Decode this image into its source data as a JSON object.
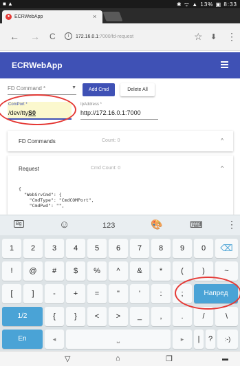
{
  "status": {
    "left_icons": "■ ▲",
    "right_text": "✱ ᯤ ▲ 13% ▣ 8:33"
  },
  "browser": {
    "tab_title": "ECRWebApp",
    "tab_close": "×",
    "back": "←",
    "forward": "→",
    "reload": "C",
    "url_host": "172.16.0.1",
    "url_path": ":7000/fd-request",
    "star": "☆",
    "download": "⬇",
    "more": "⋮"
  },
  "app": {
    "title": "ECRWebApp",
    "fd_command_placeholder": "FD Command *",
    "add_cmd_label": "Add Cmd",
    "delete_all_label": "Delete All",
    "comport_label": "ComPort *",
    "comport_value_prefix": "/dev/tty",
    "comport_value_highlight": "S0",
    "ip_label": "IpAddress *",
    "ip_value": "http://172.16.0.1:7000",
    "fd_commands_title": "FD Commands",
    "fd_commands_count": "Count: 0",
    "request_title": "Request",
    "request_count": "Cmd Count: 0",
    "request_code": "{\n  \"WebSrvCmd\": {\n    \"CmdType\": \"CmdCOMPort\",\n    \"CmdPwd\": \"\","
  },
  "keyboard": {
    "toolbar": [
      "Вg",
      "☺",
      "123",
      "🎨",
      "⌨",
      "⋮"
    ],
    "row1": [
      "1",
      "2",
      "3",
      "4",
      "5",
      "6",
      "7",
      "8",
      "9",
      "0",
      "⌫"
    ],
    "row2": [
      "!",
      "@",
      "#",
      "$",
      "%",
      "^",
      "&",
      "*",
      "(",
      ")",
      "~"
    ],
    "row3": [
      "[",
      "]",
      "-",
      "+",
      "=",
      "\"",
      "'",
      ":",
      ";"
    ],
    "enter_label": "Напред",
    "row4": [
      "1/2",
      "{",
      "}",
      "<",
      ">",
      "_",
      ",",
      ".",
      "/",
      "\\"
    ],
    "row5": [
      "En",
      "◂",
      "⎵",
      "▸",
      "|",
      "?",
      ":-)"
    ]
  },
  "nav": {
    "back": "▽",
    "home": "⌂",
    "recents": "❐",
    "keyboard": "▬"
  }
}
